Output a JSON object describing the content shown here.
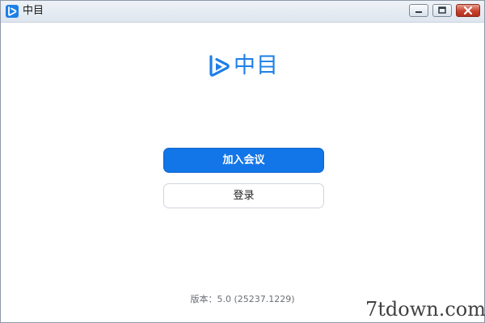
{
  "window": {
    "title": "中目",
    "controls": {
      "minimize": "minimize-icon",
      "maximize": "maximize-icon",
      "close": "close-icon"
    }
  },
  "logo": {
    "text": "中目",
    "icon": "zhongmu-logo-icon",
    "color": "#1e7fe6"
  },
  "actions": {
    "join_label": "加入会议",
    "login_label": "登录"
  },
  "footer": {
    "version_text": "版本：5.0 (25237.1229)"
  },
  "watermark": {
    "text": "7tdown.com"
  },
  "colors": {
    "accent": "#1275e8",
    "close_button": "#c8402c"
  }
}
